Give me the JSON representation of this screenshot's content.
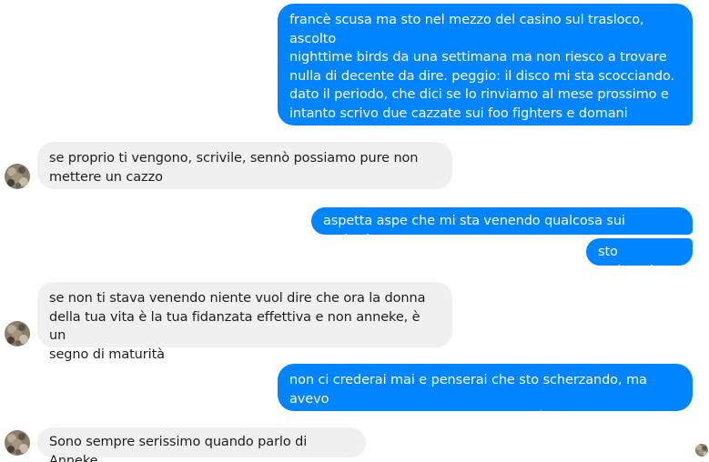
{
  "conversation": {
    "messages": [
      {
        "direction": "outgoing",
        "text": "francè scusa ma sto nel mezzo del casino sul trasloco, ascolto\nnighttime birds da una settimana ma non riesco a trovare\nnulla di decente da dire. peggio: il disco mi sta scocciando.\ndato il periodo, che dici se lo rinviamo al mese prossimo e\nintanto scrivo due cazzate sui foo fighters e domani\nmettiamo quella?"
      },
      {
        "direction": "incoming",
        "text": "se proprio ti vengono, scrivile, sennò possiamo pure non\nmettere un cazzo"
      },
      {
        "direction": "outgoing",
        "text": "aspetta aspe che mi sta venendo qualcosa sui gathering"
      },
      {
        "direction": "outgoing",
        "text": "sto scrivendo"
      },
      {
        "direction": "incoming",
        "text": "se non ti stava venendo niente vuol dire che ora la donna\ndella tua vita è la tua fidanzata effettiva e non anneke, è un\nsegno di maturità"
      },
      {
        "direction": "outgoing",
        "text": "non ci crederai mai e penserai che sto scherzando, ma avevo\niniziato la recensione esattamente così"
      },
      {
        "direction": "incoming",
        "text": "Sono sempre serissimo quando parlo di Anneke"
      }
    ]
  },
  "colors": {
    "outgoing_bubble": "#0084ff",
    "incoming_bubble": "#f1f0f0",
    "outgoing_text": "#ffffff",
    "incoming_text": "#1c1e21"
  },
  "icons": {
    "contact_avatar": "avatar-photo",
    "seen_indicator": "seen-avatar-photo"
  }
}
